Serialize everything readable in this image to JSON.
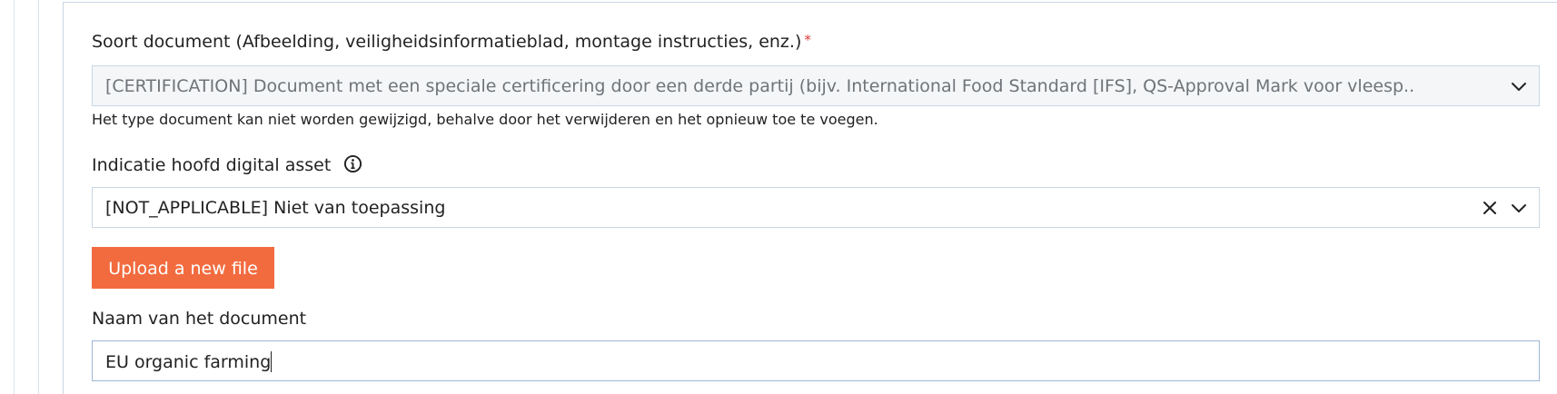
{
  "doc_type": {
    "label": "Soort document (Afbeelding, veiligheidsinformatieblad, montage instructies, enz.)",
    "required_marker": "*",
    "value": "[CERTIFICATION] Document met een speciale certificering door een derde partij (bijv. International Food Standard [IFS], QS-Approval Mark voor vleesp..",
    "helper": "Het type document kan niet worden gewijzigd, behalve door het verwijderen en het opnieuw toe te voegen.",
    "disabled": true
  },
  "main_asset": {
    "label": "Indicatie hoofd digital asset",
    "value": "[NOT_APPLICABLE] Niet van toepassing",
    "icons": [
      "info-icon",
      "clear-icon",
      "chevron-down-icon"
    ]
  },
  "upload": {
    "label": "Upload a new file"
  },
  "doc_name": {
    "label": "Naam van het document",
    "value": "EU organic farming"
  },
  "colors": {
    "accent": "#f26b3f",
    "required": "#e03a3a",
    "border": "#c9d7e6",
    "focus_border": "#9db7d8"
  }
}
